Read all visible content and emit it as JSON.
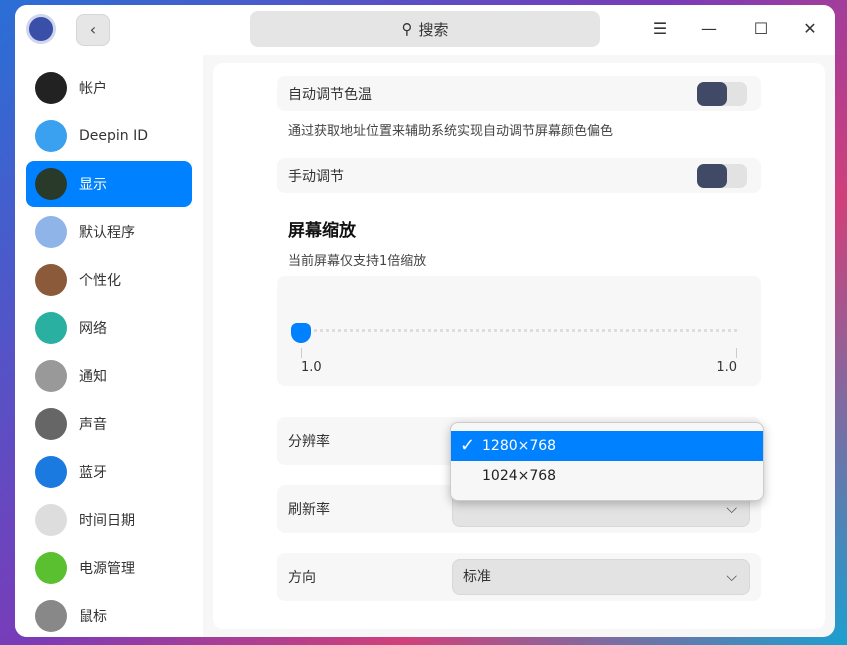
{
  "titlebar": {
    "search_placeholder": "搜索"
  },
  "sidebar": {
    "items": [
      {
        "label": "帐户",
        "icon": "account-icon",
        "color": "#222"
      },
      {
        "label": "Deepin ID",
        "icon": "cloud-icon",
        "color": "#3aa0f0"
      },
      {
        "label": "显示",
        "icon": "display-icon",
        "color": "#2a3a2a"
      },
      {
        "label": "默认程序",
        "icon": "default-apps-icon",
        "color": "#8fb4e8"
      },
      {
        "label": "个性化",
        "icon": "personalization-icon",
        "color": "#8a5a3a"
      },
      {
        "label": "网络",
        "icon": "network-icon",
        "color": "#2ab0a0"
      },
      {
        "label": "通知",
        "icon": "bell-icon",
        "color": "#999"
      },
      {
        "label": "声音",
        "icon": "speaker-icon",
        "color": "#666"
      },
      {
        "label": "蓝牙",
        "icon": "bluetooth-icon",
        "color": "#1a7ae0"
      },
      {
        "label": "时间日期",
        "icon": "clock-icon",
        "color": "#ddd"
      },
      {
        "label": "电源管理",
        "icon": "battery-icon",
        "color": "#5ac030"
      },
      {
        "label": "鼠标",
        "icon": "mouse-icon",
        "color": "#888"
      }
    ],
    "active": 2
  },
  "display": {
    "auto_color_temp": "自动调节色温",
    "auto_color_temp_desc": "通过获取地址位置来辅助系统实现自动调节屏幕颜色偏色",
    "manual_adjust": "手动调节",
    "scaling_title": "屏幕缩放",
    "scaling_desc": "当前屏幕仅支持1倍缩放",
    "scale_min": "1.0",
    "scale_max": "1.0",
    "scale_value": 1.0,
    "resolution_label": "分辨率",
    "resolution_options": [
      "1280×768",
      "1024×768"
    ],
    "resolution_selected": "1280×768",
    "refresh_label": "刷新率",
    "refresh_value": "",
    "orientation_label": "方向",
    "orientation_value": "标准"
  }
}
